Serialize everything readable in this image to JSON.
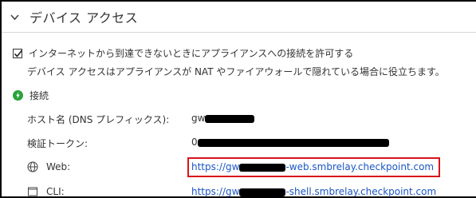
{
  "section": {
    "title": "デバイス アクセス"
  },
  "checkbox": {
    "label": "インターネットから到達できないときにアプライアンスへの接続を許可する",
    "checked": true
  },
  "description": "デバイス アクセスはアプライアンスが NAT やファイアウォールで隠れている場合に役立ちます。",
  "status": {
    "label": "接続",
    "color": "#2aa33a"
  },
  "fields": {
    "hostname": {
      "label": "ホスト名 (DNS プレフィックス):",
      "value_visible": "gw"
    },
    "token": {
      "label": "検証トークン:",
      "value_visible": "0"
    },
    "web": {
      "label": "Web:",
      "prefix": "https://gw",
      "suffix": "-web.smbrelay.checkpoint.com"
    },
    "cli": {
      "label": "CLI:",
      "prefix": "https://gw",
      "suffix": "-shell.smbrelay.checkpoint.com"
    }
  },
  "colors": {
    "link": "#1a56c4",
    "highlight_border": "#d9141b",
    "status_green": "#2aa33a"
  }
}
